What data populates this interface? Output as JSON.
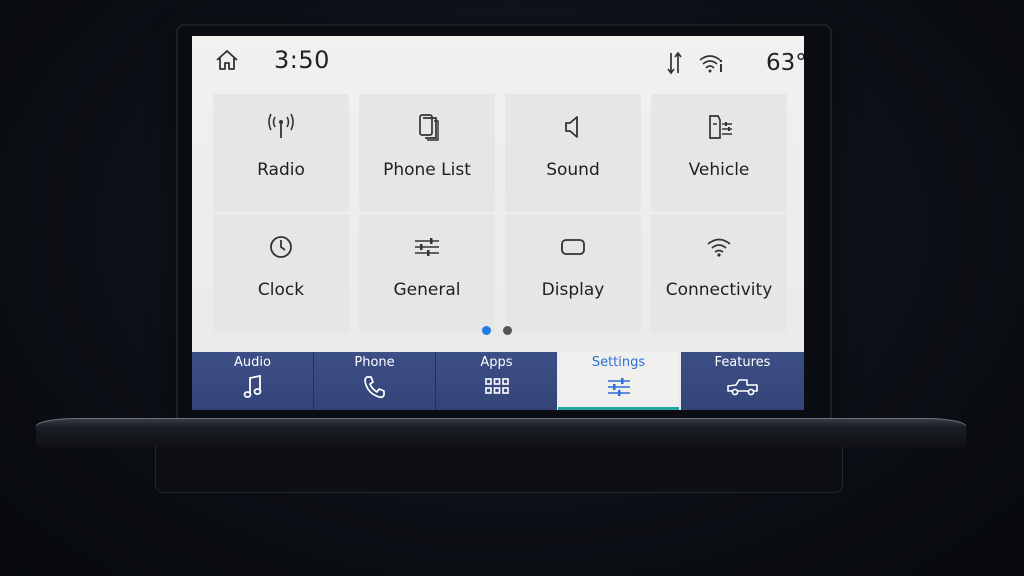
{
  "status": {
    "time": "3:50",
    "temperature": "63°"
  },
  "tiles": [
    {
      "label": "Radio",
      "icon": "radio-antenna-icon"
    },
    {
      "label": "Phone List",
      "icon": "phone-list-icon"
    },
    {
      "label": "Sound",
      "icon": "speaker-icon"
    },
    {
      "label": "Vehicle",
      "icon": "vehicle-settings-icon"
    },
    {
      "label": "Clock",
      "icon": "clock-icon"
    },
    {
      "label": "General",
      "icon": "sliders-icon"
    },
    {
      "label": "Display",
      "icon": "display-icon"
    },
    {
      "label": "Connectivity",
      "icon": "wifi-icon"
    }
  ],
  "pager": {
    "pages": 2,
    "current": 1,
    "active_color": "#1e7be0",
    "inactive_color": "#555555"
  },
  "nav": [
    {
      "label": "Audio",
      "icon": "music-note-icon"
    },
    {
      "label": "Phone",
      "icon": "phone-handset-icon"
    },
    {
      "label": "Apps",
      "icon": "apps-grid-icon"
    },
    {
      "label": "Settings",
      "icon": "settings-sliders-icon",
      "active": true
    },
    {
      "label": "Features",
      "icon": "truck-icon"
    }
  ],
  "colors": {
    "nav_bg": "#3c4f86",
    "active_label": "#2d6fd6",
    "active_bar": "#1ea9a0"
  }
}
